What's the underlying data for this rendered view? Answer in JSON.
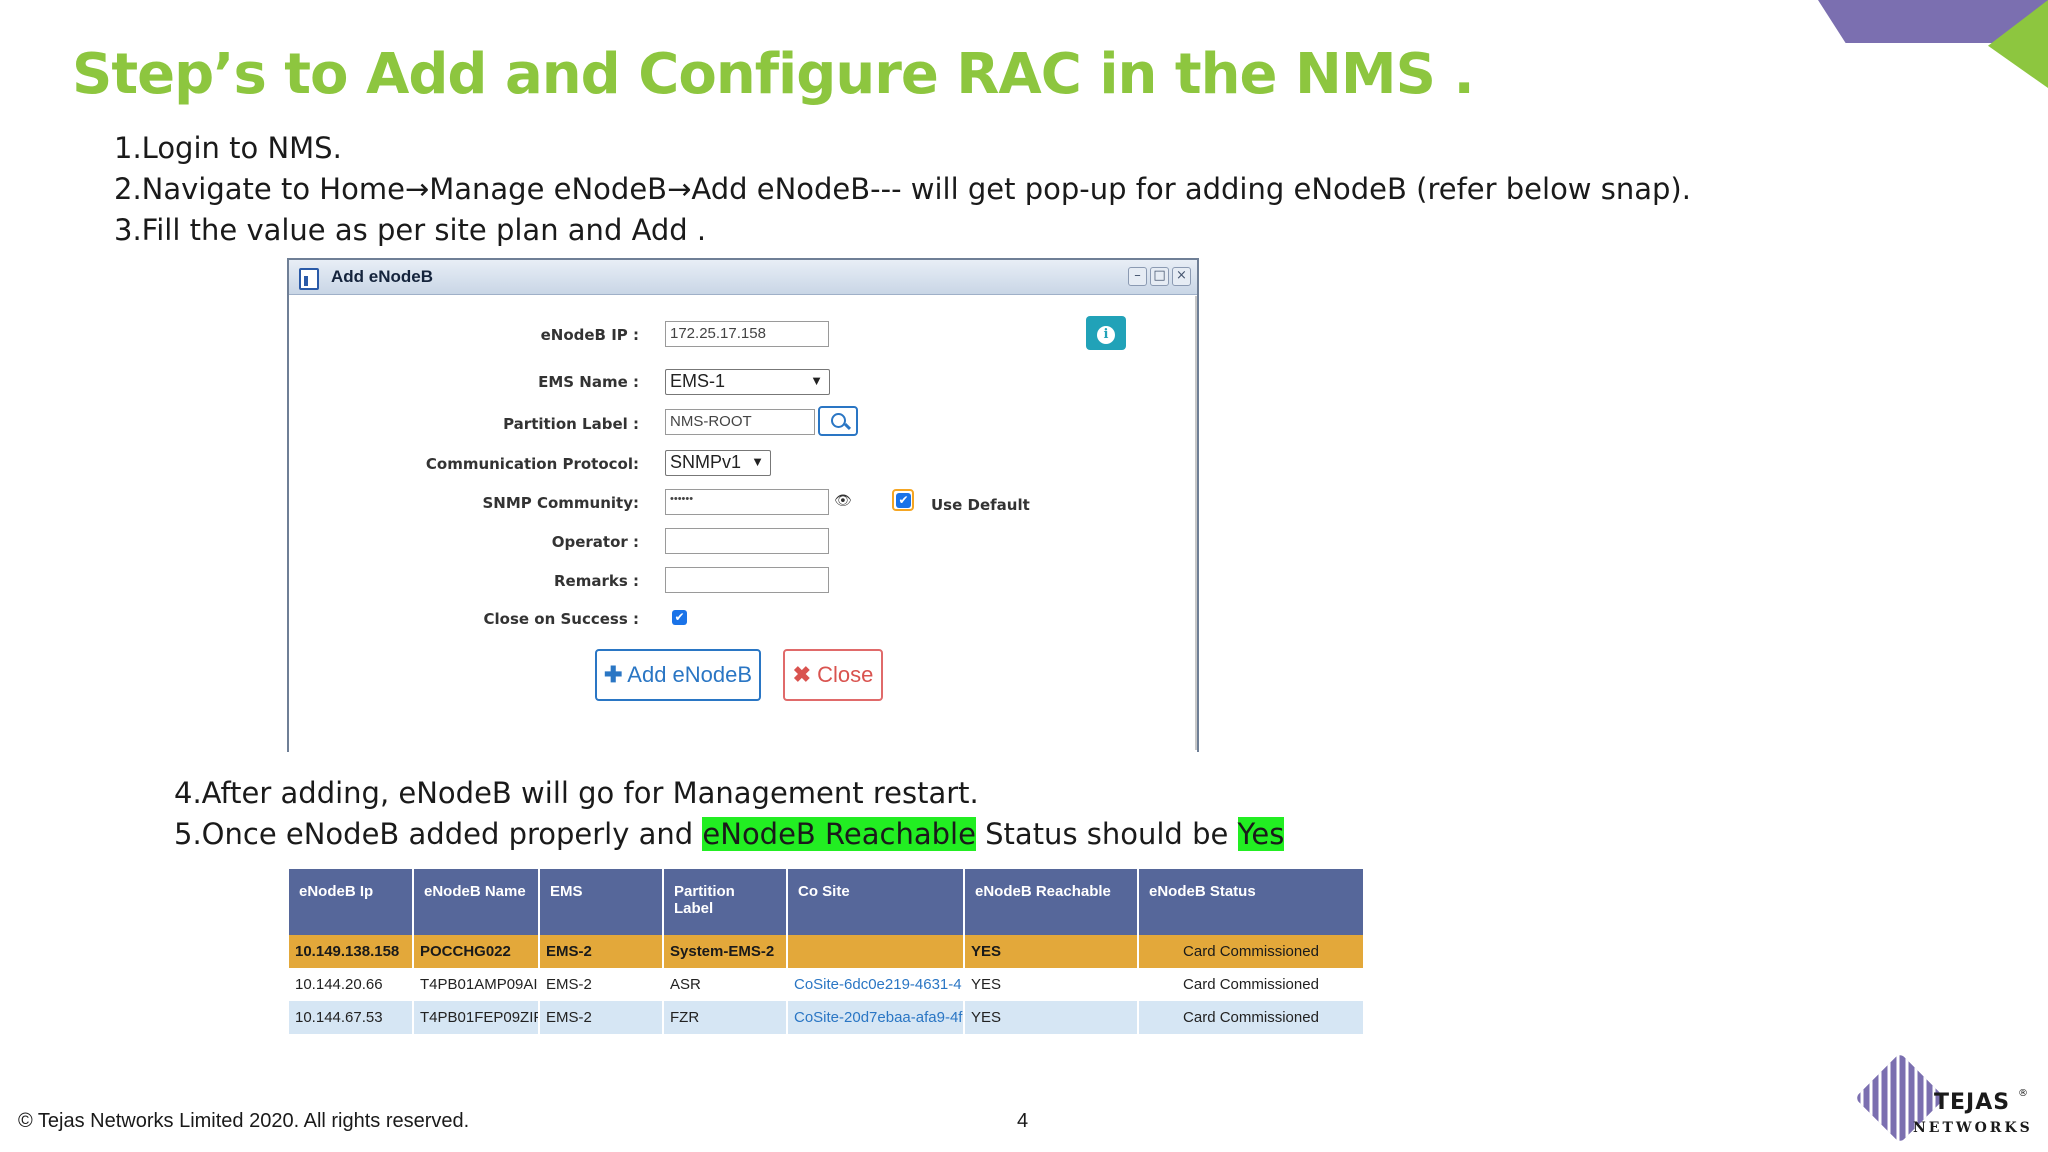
{
  "slide": {
    "title": "Step’s to Add and Configure RAC in the NMS .",
    "steps": [
      "1.Login to NMS.",
      "2.Navigate to Home→Manage eNodeB→Add eNodeB--- will get pop-up for adding eNodeB (refer below snap).",
      "3.Fill the value as per site plan and Add ."
    ],
    "step4": "4.After adding, eNodeB will go for Management restart.",
    "step5_before": "5.Once eNodeB added properly and ",
    "step5_hl1": "eNodeB Reachable",
    "step5_mid": " Status should be ",
    "step5_hl2": "Yes",
    "highlight_color": "#22ee22",
    "title_color": "#8dc63f"
  },
  "dialog": {
    "title": "Add eNodeB",
    "fields": {
      "enodeb_ip_label": "eNodeB IP :",
      "enodeb_ip_value": "172.25.17.158",
      "ems_name_label": "EMS Name :",
      "ems_name_value": "EMS-1",
      "partition_label_label": "Partition Label :",
      "partition_label_value": "NMS-ROOT",
      "protocol_label": "Communication Protocol:",
      "protocol_value": "SNMPv1",
      "snmp_label": "SNMP Community:",
      "snmp_value": "••••••",
      "use_default_label": "Use Default",
      "operator_label": "Operator :",
      "remarks_label": "Remarks :",
      "close_on_success_label": "Close on Success :"
    },
    "buttons": {
      "add": "Add eNodeB",
      "close": "Close"
    }
  },
  "table": {
    "headers": [
      "eNodeB Ip",
      "eNodeB Name",
      "EMS",
      "Partition Label",
      "Co Site",
      "eNodeB Reachable",
      "eNodeB Status"
    ],
    "rows": [
      [
        "10.149.138.158",
        "POCCHG022",
        "EMS-2",
        "System-EMS-2",
        "",
        "YES",
        "Card Commissioned"
      ],
      [
        "10.144.20.66",
        "T4PB01AMP09AI",
        "EMS-2",
        "ASR",
        "CoSite-6dc0e219-4631-4",
        "YES",
        "Card Commissioned"
      ],
      [
        "10.144.67.53",
        "T4PB01FEP09ZIF",
        "EMS-2",
        "FZR",
        "CoSite-20d7ebaa-afa9-4f",
        "YES",
        "Card Commissioned"
      ]
    ]
  },
  "footer": {
    "copyright": "© Tejas Networks Limited 2020. All rights reserved.",
    "page": "4",
    "logo_line1": "TEJAS",
    "logo_line2": "NETWORKS",
    "logo_tm": "®"
  }
}
